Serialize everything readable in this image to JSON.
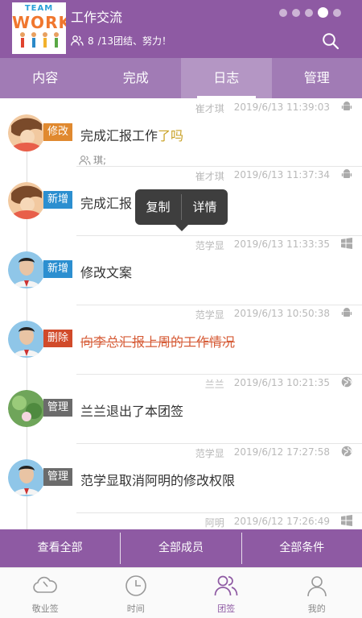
{
  "header": {
    "logo_team": "TEAM",
    "logo_work": "WORK",
    "title": "工作交流",
    "member_count": "8",
    "subtitle_suffix": "/13团结、努力！",
    "page_dots": 5,
    "active_dot": 4
  },
  "tabs": [
    {
      "label": "内容"
    },
    {
      "label": "完成"
    },
    {
      "label": "日志",
      "active": true
    },
    {
      "label": "管理"
    }
  ],
  "entries": [
    {
      "user": "崔才琪",
      "time": "2019/6/13 11:39:03",
      "platform": "android-icon",
      "badge": "修改",
      "badge_type": "edit",
      "text": "完成汇报工作",
      "text_highlight": "了吗",
      "reader": "琪;"
    },
    {
      "user": "崔才琪",
      "time": "2019/6/13 11:37:34",
      "platform": "android-icon",
      "badge": "新增",
      "badge_type": "add",
      "text": "完成汇报"
    },
    {
      "user": "范学显",
      "time": "2019/6/13 11:33:35",
      "platform": "windows-icon",
      "badge": "新增",
      "badge_type": "add",
      "text": "修改文案"
    },
    {
      "user": "范学显",
      "time": "2019/6/13 10:50:38",
      "platform": "android-icon",
      "badge": "删除",
      "badge_type": "del",
      "text": "向李总汇报上周的工作情况"
    },
    {
      "user": "兰兰",
      "time": "2019/6/13 10:21:35",
      "platform": "globe-icon",
      "badge": "管理",
      "badge_type": "mgr",
      "text": "兰兰退出了本团签"
    },
    {
      "user": "范学显",
      "time": "2019/6/12 17:27:58",
      "platform": "globe-icon",
      "badge": "管理",
      "badge_type": "mgr",
      "text": "范学显取消阿明的修改权限"
    },
    {
      "user": "阿明",
      "time": "2019/6/12 17:26:49",
      "platform": "windows-icon"
    }
  ],
  "popup": {
    "copy": "复制",
    "detail": "详情"
  },
  "actions": {
    "view_all": "查看全部",
    "all_members": "全部成员",
    "all_items": "全部条件"
  },
  "nav": [
    {
      "label": "敬业签",
      "icon": "cloud-icon"
    },
    {
      "label": "时间",
      "icon": "clock-icon"
    },
    {
      "label": "团签",
      "icon": "group-icon",
      "active": true
    },
    {
      "label": "我的",
      "icon": "person-icon"
    }
  ],
  "colors": {
    "brand": "#8e5aa3",
    "tab_bar": "#a17bb5",
    "edit": "#e0892f",
    "add": "#2c8fd0",
    "delete": "#d14a2a",
    "manage": "#6b6b6b",
    "highlight": "#c9a227"
  }
}
